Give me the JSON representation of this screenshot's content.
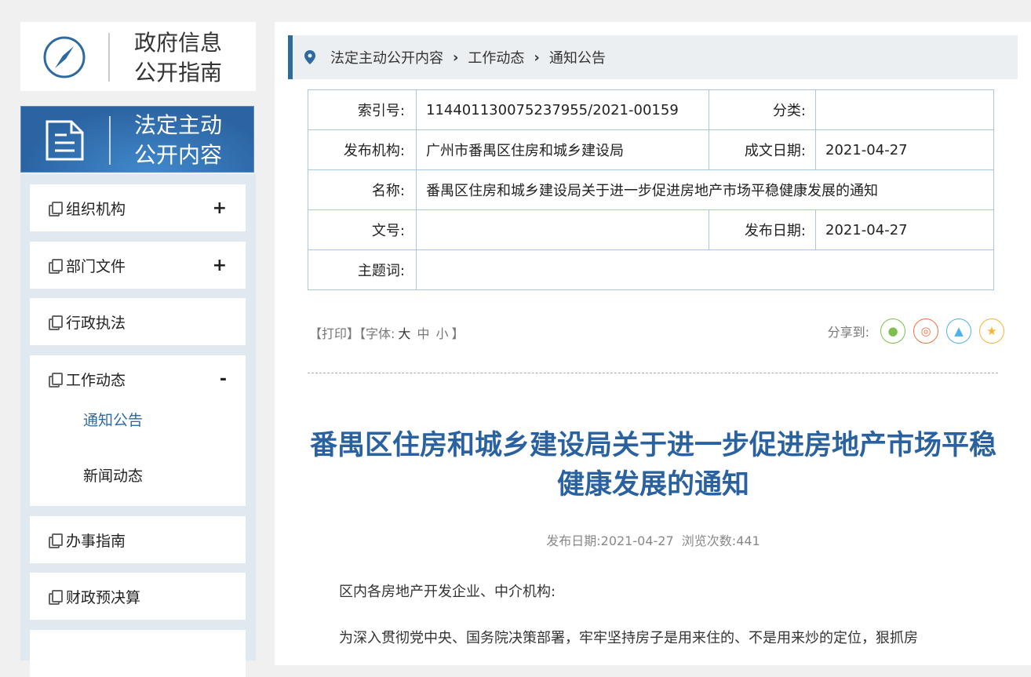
{
  "sidebar": {
    "guide_title_1": "政府信息",
    "guide_title_2": "公开指南",
    "banner_title_1": "法定主动",
    "banner_title_2": "公开内容",
    "items": [
      {
        "label": "组织机构",
        "toggle": "+"
      },
      {
        "label": "部门文件",
        "toggle": "+"
      },
      {
        "label": "行政执法"
      },
      {
        "label": "工作动态",
        "toggle": "-",
        "children": [
          "通知公告",
          "新闻动态"
        ]
      },
      {
        "label": "办事指南"
      },
      {
        "label": "财政预决算"
      }
    ]
  },
  "breadcrumb": [
    "法定主动公开内容",
    "工作动态",
    "通知公告"
  ],
  "info": {
    "index_label": "索引号:",
    "index": "114401130075237955/2021-00159",
    "category_label": "分类:",
    "category": "",
    "org_label": "发布机构:",
    "org": "广州市番禺区住房和城乡建设局",
    "created_label": "成文日期:",
    "created": "2021-04-27",
    "name_label": "名称:",
    "name": "番禺区住房和城乡建设局关于进一步促进房地产市场平稳健康发展的通知",
    "docno_label": "文号:",
    "docno": "",
    "pub_label": "发布日期:",
    "pub": "2021-04-27",
    "keywords_label": "主题词:",
    "keywords": ""
  },
  "tools": {
    "print": "【打印】",
    "font_open": "【字体:",
    "large": "大",
    "medium": "中",
    "small": "小",
    "font_close": "】",
    "share": "分享到:"
  },
  "share_icons": [
    "wechat-icon",
    "weibo-icon",
    "qq-icon",
    "qzone-icon"
  ],
  "article": {
    "title": "番禺区住房和城乡建设局关于进一步促进房地产市场平稳健康发展的通知",
    "meta": "发布日期:2021-04-27  浏览次数:441",
    "p1": "区内各房地产开发企业、中介机构:",
    "p2": "为深入贯彻党中央、国务院决策部署，牢牢坚持房子是用来住的、不是用来炒的定位，狠抓房"
  }
}
